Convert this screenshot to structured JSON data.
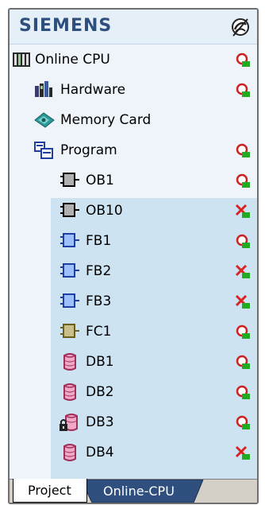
{
  "brand": {
    "text": "SIEMENS",
    "icon": "connection-icon"
  },
  "tree": {
    "online_cpu": {
      "label": "Online CPU",
      "icon": "cpu-icon",
      "status": "ok"
    },
    "hardware": {
      "label": "Hardware",
      "icon": "hardware-icon",
      "status": "ok"
    },
    "memory_card": {
      "label": "Memory Card",
      "icon": "memory-card-icon"
    },
    "program": {
      "label": "Program",
      "icon": "program-icon",
      "status": "ok"
    },
    "blocks": [
      {
        "label": "OB1",
        "icon": "ob-block-icon",
        "status": "ok"
      },
      {
        "label": "OB10",
        "icon": "ob-block-icon",
        "status": "error"
      },
      {
        "label": "FB1",
        "icon": "fb-block-icon",
        "status": "ok"
      },
      {
        "label": "FB2",
        "icon": "fb-block-icon",
        "status": "error"
      },
      {
        "label": "FB3",
        "icon": "fb-block-icon",
        "status": "error"
      },
      {
        "label": "FC1",
        "icon": "fc-block-icon",
        "status": "ok"
      },
      {
        "label": "DB1",
        "icon": "db-block-icon",
        "status": "ok"
      },
      {
        "label": "DB2",
        "icon": "db-block-icon",
        "status": "ok"
      },
      {
        "label": "DB3",
        "icon": "db-block-locked-icon",
        "status": "ok"
      },
      {
        "label": "DB4",
        "icon": "db-block-icon",
        "status": "error"
      }
    ]
  },
  "tabs": {
    "project": "Project",
    "online": "Online-CPU"
  },
  "colors": {
    "brand": "#2e4f7d",
    "program_highlight": "#cde3f2",
    "ok": "#22aa22",
    "error": "#dd2222",
    "active_tab": "#2f4f7f"
  }
}
